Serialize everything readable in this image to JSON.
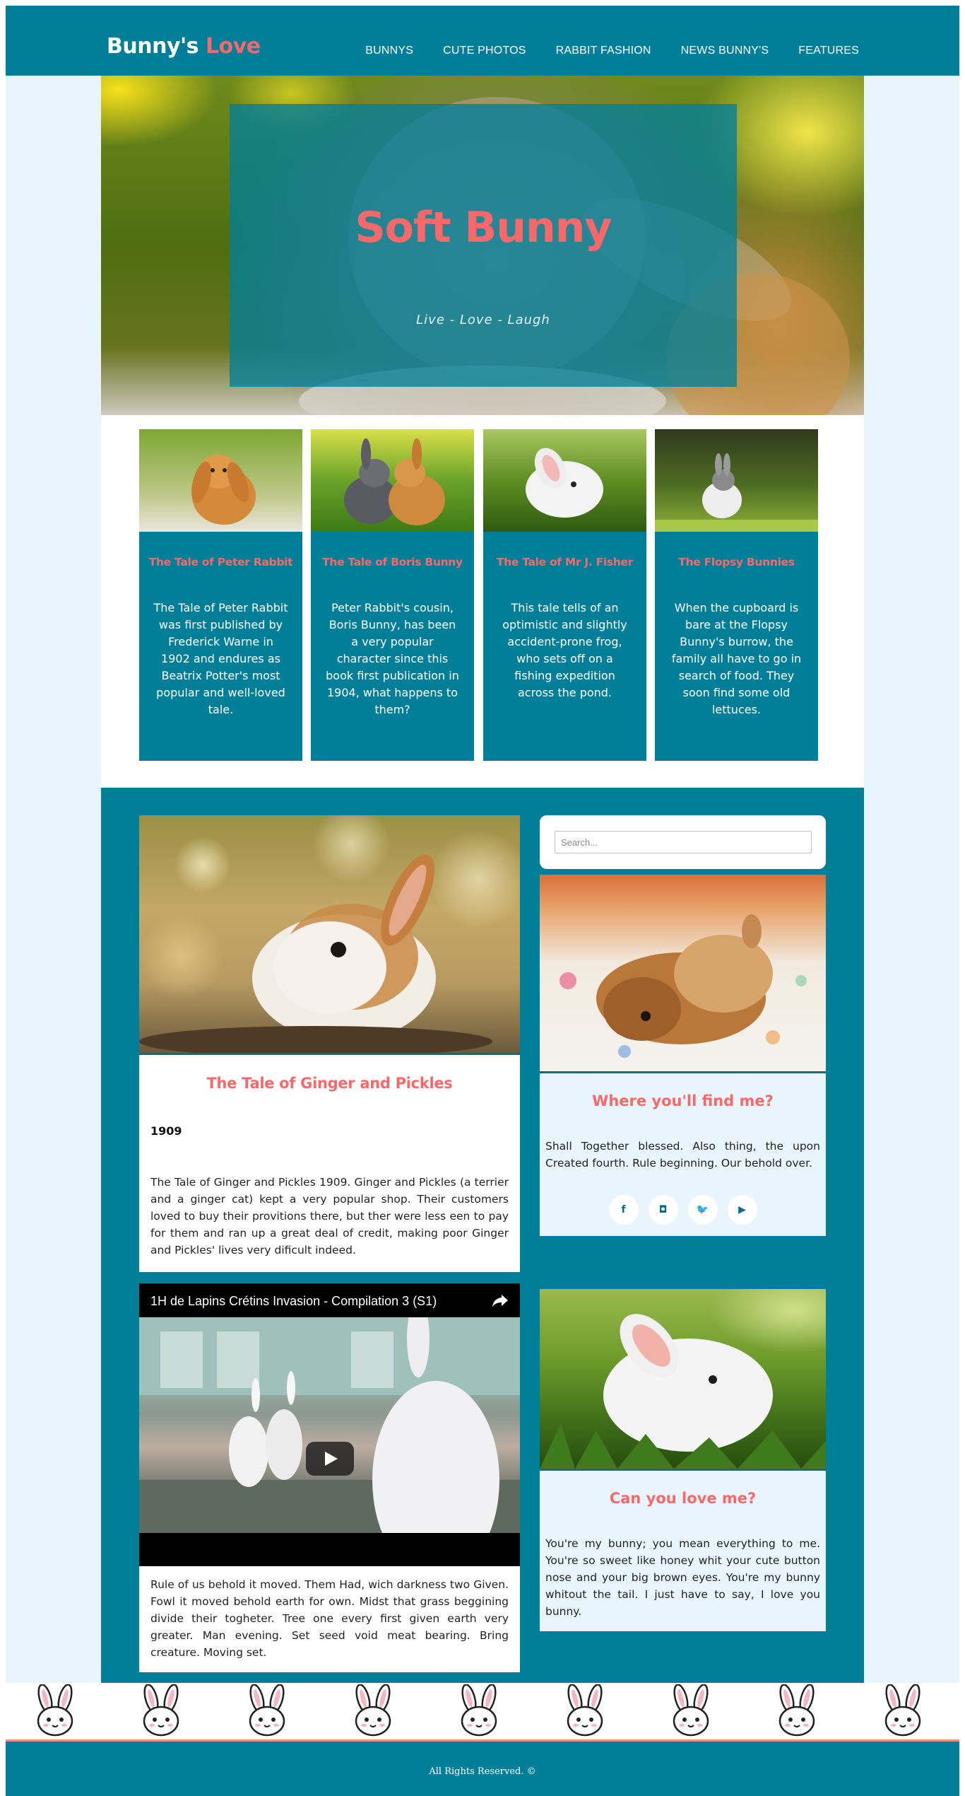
{
  "header": {
    "logo_main": "Bunny's",
    "logo_accent": "Love",
    "nav": [
      {
        "label": "BUNNYS"
      },
      {
        "label": "CUTE PHOTOS"
      },
      {
        "label": "RABBIT FASHION"
      },
      {
        "label": "NEWS BUNNY'S"
      },
      {
        "label": "FEATURES"
      }
    ]
  },
  "hero": {
    "title": "Soft Bunny",
    "subtitle": "Live - Love - Laugh"
  },
  "cards": [
    {
      "title": "The Tale of Peter Rabbit",
      "text": "The Tale of Peter Rabbit was first published by Frederick Warne in 1902 and endures as Beatrix Potter's most popular and well-loved tale."
    },
    {
      "title": "The Tale of Boris Bunny",
      "text": "Peter Rabbit's cousin, Boris Bunny, has been a very popular character since this book first publication in 1904, what happens to them?"
    },
    {
      "title": "The Tale of Mr J. Fisher",
      "text": "This tale tells of an optimistic and slightly accident-prone frog, who sets off on a fishing expedition across the pond."
    },
    {
      "title": "The Flopsy Bunnies",
      "text": "When the cupboard is bare at the Flopsy Bunny's burrow, the family all have to go in search of food. They soon find some old lettuces."
    }
  ],
  "article": {
    "title": "The Tale of Ginger and Pickles",
    "year": "1909",
    "body": "The Tale of Ginger and Pickles 1909. Ginger and Pickles (a terrier and a ginger cat) kept a very popular shop. Their customers loved to buy their provitions there, but ther were less een to pay for them and ran up a great deal of credit, making poor Ginger and Pickles' lives very dificult indeed."
  },
  "video": {
    "title": "1H de Lapins Crétins Invasion - Compilation 3 (S1)",
    "caption": "Rule of us behold it moved. Them Had, wich darkness two Given. Fowl it moved behold earth for own. Midst that grass beggining divide their togheter. Tree one every first given earth very greater. Man evening. Set seed void meat bearing. Bring creature. Moving set."
  },
  "sidebar": {
    "search_placeholder": "Search...",
    "widget1": {
      "title": "Where you'll find me?",
      "text": "Shall Together blessed. Also thing, the upon Created fourth. Rule beginning. Our behold over.",
      "socials": [
        {
          "icon": "facebook-icon",
          "glyph": "f"
        },
        {
          "icon": "instagram-icon",
          "glyph": "◘"
        },
        {
          "icon": "twitter-icon",
          "glyph": "🐦"
        },
        {
          "icon": "youtube-icon",
          "glyph": "▶"
        }
      ]
    },
    "widget2": {
      "title": "Can you love me?",
      "text": "You're my bunny; you mean everything to me. You're so sweet like honey whit your cute button nose and your big brown eyes. You're my bunny whitout the tail. I just have to say, I love you bunny."
    }
  },
  "footer": {
    "text": "All Rights Reserved. ©"
  },
  "colors": {
    "teal": "#017f99",
    "accent_pink": "#f7686b",
    "page_bg": "#e9f5fc"
  }
}
